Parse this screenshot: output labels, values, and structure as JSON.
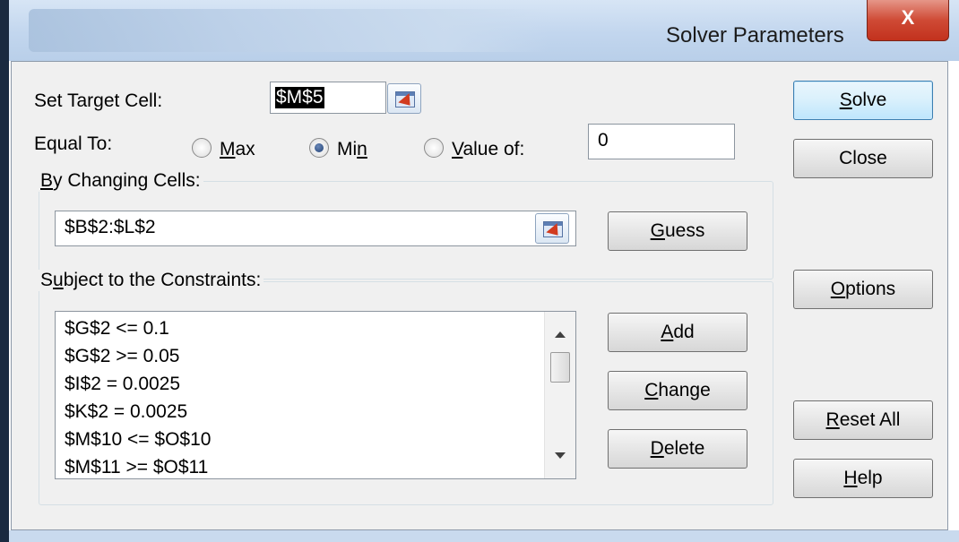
{
  "window": {
    "title": "Solver Parameters",
    "close_glyph": "X"
  },
  "target": {
    "label": "Set Target Cell:",
    "value": "$M$5"
  },
  "equal_to": {
    "label": "Equal To:",
    "options": [
      {
        "label_pre": "",
        "label_u": "M",
        "label_post": "ax",
        "selected": false
      },
      {
        "label_pre": "Mi",
        "label_u": "n",
        "label_post": "",
        "selected": true
      },
      {
        "label_pre": "",
        "label_u": "V",
        "label_post": "alue of:",
        "selected": false
      }
    ],
    "value_of": "0"
  },
  "changing": {
    "label_u": "B",
    "label_rest": "y Changing Cells:",
    "value": "$B$2:$L$2",
    "guess_u": "G",
    "guess_rest": "uess"
  },
  "constraints": {
    "label_pre": "S",
    "label_u": "u",
    "label_post": "bject to the Constraints:",
    "items": [
      "$G$2 <= 0.1",
      "$G$2 >= 0.05",
      "$I$2 = 0.0025",
      "$K$2 = 0.0025",
      "$M$10 <= $O$10",
      "$M$11 >= $O$11"
    ]
  },
  "buttons": {
    "solve": {
      "u": "S",
      "rest": "olve"
    },
    "close": {
      "text": "Close"
    },
    "options": {
      "u": "O",
      "rest": "ptions"
    },
    "add": {
      "u": "A",
      "rest": "dd"
    },
    "change": {
      "u": "C",
      "rest": "hange"
    },
    "delete": {
      "u": "D",
      "rest": "elete"
    },
    "reset": {
      "u": "R",
      "rest": "eset All"
    },
    "help": {
      "u": "H",
      "rest": "elp"
    }
  },
  "colors": {
    "dialog_bg": "#f0f0f0",
    "close_button": "#c9412a",
    "default_button_border": "#3c7fb1",
    "selection_highlight": "#000000"
  }
}
